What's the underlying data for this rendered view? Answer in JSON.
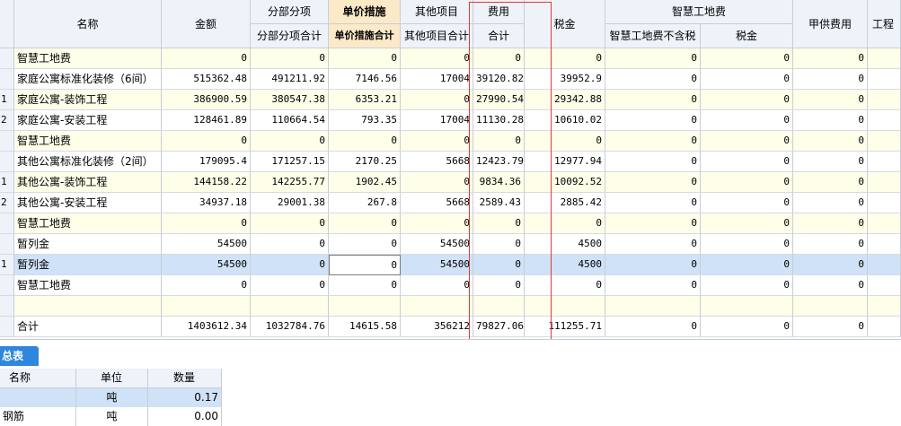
{
  "main_table": {
    "headers": {
      "name": "名称",
      "amount": "金额",
      "sub_items": "分部分项",
      "sub_items_total": "分部分项合计",
      "unit_measures": "单价措施",
      "unit_measures_total": "单价措施合计",
      "other_items": "其他项目",
      "other_items_total": "其他项目合计",
      "fees": "费用",
      "fees_total": "合计",
      "tax": "税金",
      "smart_site": "智慧工地费",
      "smart_site_pretax": "智慧工地费不含税",
      "smart_site_tax": "税金",
      "owner_supplied": "甲供费用",
      "engineering_cut": "工程"
    },
    "rows": [
      {
        "idx": "",
        "name": "智慧工地费",
        "amount": "0",
        "sub": "0",
        "unit": "0",
        "other": "0",
        "fees": "0",
        "tax": "0",
        "pretax": "0",
        "stax": "0",
        "owner": "0",
        "eng": ""
      },
      {
        "idx": "",
        "name": "家庭公寓标准化装修（6间）",
        "amount": "515362.48",
        "sub": "491211.92",
        "unit": "7146.56",
        "other": "17004",
        "fees": "39120.82",
        "tax": "39952.9",
        "pretax": "0",
        "stax": "0",
        "owner": "0",
        "eng": ""
      },
      {
        "idx": "1",
        "name": "家庭公寓-装饰工程",
        "amount": "386900.59",
        "sub": "380547.38",
        "unit": "6353.21",
        "other": "0",
        "fees": "27990.54",
        "tax": "29342.88",
        "pretax": "0",
        "stax": "0",
        "owner": "0",
        "eng": ""
      },
      {
        "idx": "2",
        "name": "家庭公寓-安装工程",
        "amount": "128461.89",
        "sub": "110664.54",
        "unit": "793.35",
        "other": "17004",
        "fees": "11130.28",
        "tax": "10610.02",
        "pretax": "0",
        "stax": "0",
        "owner": "0",
        "eng": ""
      },
      {
        "idx": "",
        "name": "智慧工地费",
        "amount": "0",
        "sub": "0",
        "unit": "0",
        "other": "0",
        "fees": "0",
        "tax": "0",
        "pretax": "0",
        "stax": "0",
        "owner": "0",
        "eng": ""
      },
      {
        "idx": "",
        "name": "其他公寓标准化装修（2间）",
        "amount": "179095.4",
        "sub": "171257.15",
        "unit": "2170.25",
        "other": "5668",
        "fees": "12423.79",
        "tax": "12977.94",
        "pretax": "0",
        "stax": "0",
        "owner": "0",
        "eng": ""
      },
      {
        "idx": "1",
        "name": "其他公寓-装饰工程",
        "amount": "144158.22",
        "sub": "142255.77",
        "unit": "1902.45",
        "other": "0",
        "fees": "9834.36",
        "tax": "10092.52",
        "pretax": "0",
        "stax": "0",
        "owner": "0",
        "eng": ""
      },
      {
        "idx": "2",
        "name": "其他公寓-安装工程",
        "amount": "34937.18",
        "sub": "29001.38",
        "unit": "267.8",
        "other": "5668",
        "fees": "2589.43",
        "tax": "2885.42",
        "pretax": "0",
        "stax": "0",
        "owner": "0",
        "eng": ""
      },
      {
        "idx": "",
        "name": "智慧工地费",
        "amount": "0",
        "sub": "0",
        "unit": "0",
        "other": "0",
        "fees": "0",
        "tax": "0",
        "pretax": "0",
        "stax": "0",
        "owner": "0",
        "eng": ""
      },
      {
        "idx": "",
        "name": "暂列金",
        "amount": "54500",
        "sub": "0",
        "unit": "0",
        "other": "54500",
        "fees": "0",
        "tax": "4500",
        "pretax": "0",
        "stax": "0",
        "owner": "0",
        "eng": ""
      },
      {
        "idx": "1",
        "name": "暂列金",
        "amount": "54500",
        "sub": "0",
        "unit": "0",
        "other": "54500",
        "fees": "0",
        "tax": "4500",
        "pretax": "0",
        "stax": "0",
        "owner": "0",
        "eng": ""
      },
      {
        "idx": "",
        "name": "智慧工地费",
        "amount": "0",
        "sub": "0",
        "unit": "0",
        "other": "0",
        "fees": "0",
        "tax": "0",
        "pretax": "0",
        "stax": "0",
        "owner": "0",
        "eng": ""
      },
      {
        "idx": "",
        "name": "",
        "amount": "",
        "sub": "",
        "unit": "",
        "other": "",
        "fees": "",
        "tax": "",
        "pretax": "",
        "stax": "",
        "owner": "",
        "eng": ""
      },
      {
        "idx": "",
        "name": "合计",
        "amount": "1403612.34",
        "sub": "1032784.76",
        "unit": "14615.58",
        "other": "356212",
        "fees": "79827.06",
        "tax": "111255.71",
        "pretax": "0",
        "stax": "0",
        "owner": "0",
        "eng": ""
      }
    ],
    "selected_row": 10
  },
  "bottom_panel": {
    "tab_label": "总表",
    "headers": {
      "name": "名称",
      "unit": "单位",
      "qty": "数量"
    },
    "rows": [
      {
        "name": "",
        "unit": "吨",
        "qty": "0.17"
      },
      {
        "name": "钢筋",
        "unit": "吨",
        "qty": "0.00"
      }
    ]
  },
  "annotation": {
    "color": "#e53935"
  }
}
